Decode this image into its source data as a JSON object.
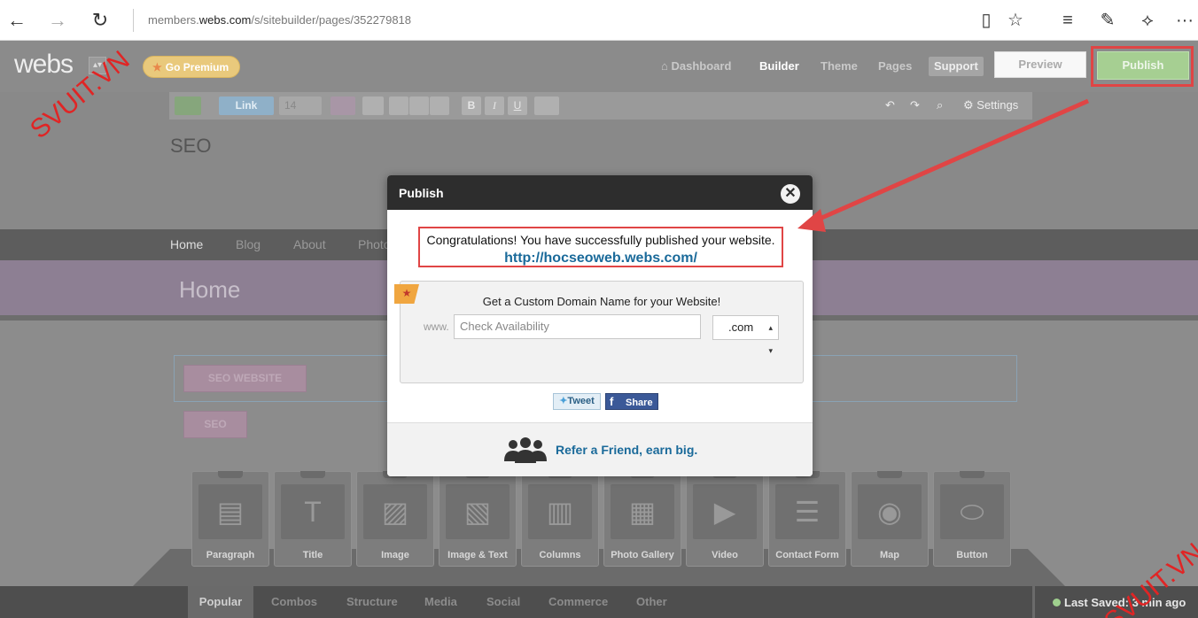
{
  "browser": {
    "url_prefix": "members.",
    "url_domain": "webs.com",
    "url_path": "/s/sitebuilder/pages/352279818",
    "back_icon": "←",
    "forward_icon": "→",
    "refresh_icon": "↻",
    "reading_icon": "▯",
    "favorite_icon": "☆",
    "hub_icon": "≡",
    "notes_icon": "✎",
    "share_icon": "⟡",
    "more_icon": "···"
  },
  "header": {
    "logo": "webs",
    "logo_drop": "▴▾",
    "go_premium": "Go Premium",
    "premium_star": "★",
    "dashboard_icon": "⌂",
    "nav": {
      "dashboard": "Dashboard",
      "builder": "Builder",
      "theme": "Theme",
      "pages": "Pages",
      "support": "Support"
    },
    "preview": "Preview",
    "publish": "Publish"
  },
  "toolbar": {
    "link": "Link",
    "font_size": "14",
    "bold": "B",
    "italic": "I",
    "underline": "U",
    "settings": "Settings"
  },
  "page": {
    "seo_title": "SEO",
    "nav": [
      "Home",
      "Blog",
      "About",
      "Photo"
    ],
    "hero_title": "Home",
    "btn_seo_website": "SEO WEBSITE",
    "btn_seo": "SEO"
  },
  "widgets": [
    {
      "label": "Paragraph",
      "icon": "▤"
    },
    {
      "label": "Title",
      "icon": "T"
    },
    {
      "label": "Image",
      "icon": "▨"
    },
    {
      "label": "Image & Text",
      "icon": "▧"
    },
    {
      "label": "Columns",
      "icon": "▥"
    },
    {
      "label": "Photo Gallery",
      "icon": "▦"
    },
    {
      "label": "Video",
      "icon": "▶"
    },
    {
      "label": "Contact Form",
      "icon": "☰"
    },
    {
      "label": "Map",
      "icon": "◉"
    },
    {
      "label": "Button",
      "icon": "⬭"
    }
  ],
  "bottom_tabs": [
    "Popular",
    "Combos",
    "Structure",
    "Media",
    "Social",
    "Commerce",
    "Other"
  ],
  "last_saved": "Last Saved: 3 min ago",
  "modal": {
    "title": "Publish",
    "close_icon": "✕",
    "congrats": "Congratulations! You have successfully published your website.",
    "site_url": "http://hocseoweb.webs.com/",
    "domain_title": "Get a Custom Domain Name for your Website!",
    "www": "www.",
    "domain_placeholder": "Check Availability",
    "tld": ".com",
    "tweet": "Tweet",
    "share": "Share",
    "refer": "Refer a Friend, earn big."
  },
  "watermark": "SVUIT.VN",
  "colors": {
    "highlight_red": "#e04545",
    "publish_green": "#a6cf92",
    "link_blue": "#1a6a9a"
  }
}
